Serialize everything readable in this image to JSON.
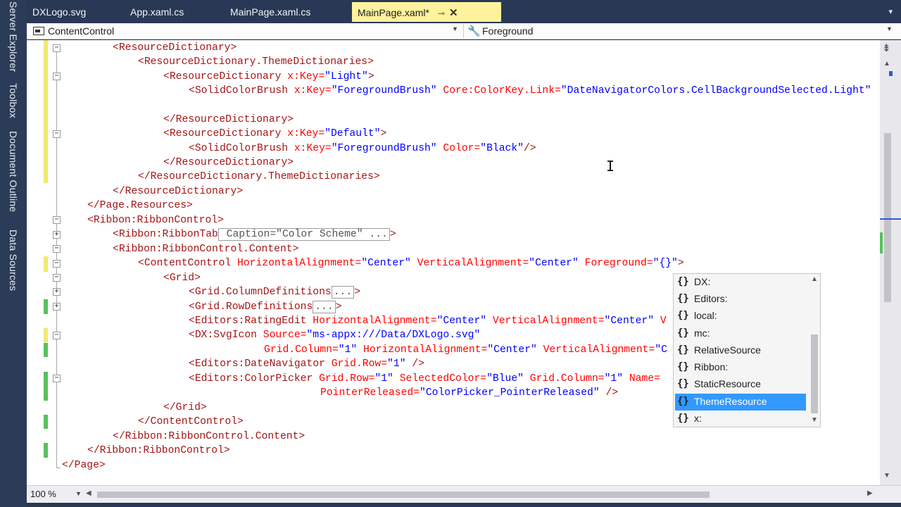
{
  "sidebar_tabs": [
    "Server Explorer",
    "Toolbox",
    "Document Outline",
    "Data Sources"
  ],
  "tabs": [
    "DXLogo.svg",
    "App.xaml.cs",
    "MainPage.xaml.cs",
    "MainPage.xaml*"
  ],
  "nav": {
    "element": "ContentControl",
    "property": "Foreground"
  },
  "code": {
    "l1": "<ResourceDictionary>",
    "l2": "<ResourceDictionary.ThemeDictionaries>",
    "l3a": "<ResourceDictionary ",
    "l3b": "x:Key=",
    "l3c": "\"Light\"",
    "l3d": ">",
    "l4a": "<SolidColorBrush ",
    "l4b": "x:Key=",
    "l4c": "\"ForegroundBrush\"",
    "l4d": " Core:ColorKey.Link=",
    "l4e": "\"DateNavigatorColors.CellBackgroundSelected.Light\"",
    "l6": "</ResourceDictionary>",
    "l7a": "<ResourceDictionary ",
    "l7b": "x:Key=",
    "l7c": "\"Default\"",
    "l7d": ">",
    "l8a": "<SolidColorBrush ",
    "l8b": "x:Key=",
    "l8c": "\"ForegroundBrush\"",
    "l8d": " Color=",
    "l8e": "\"Black\"",
    "l8f": "/>",
    "l9": "</ResourceDictionary>",
    "l10": "</ResourceDictionary.ThemeDictionaries>",
    "l11": "</ResourceDictionary>",
    "l12": "</Page.Resources>",
    "l13": "<Ribbon:RibbonControl>",
    "l14a": "<Ribbon:RibbonTab",
    "l14b": " Caption=\"Color Scheme\" ...",
    "l14c": ">",
    "l15": "<Ribbon:RibbonControl.Content>",
    "l16a": "<ContentControl ",
    "l16b": "HorizontalAlignment=",
    "l16c": "\"Center\"",
    "l16d": " VerticalAlignment=",
    "l16e": "\"Center\"",
    "l16f": " Foreground=",
    "l16g": "\"{}\"",
    "l16h": ">",
    "l17": "<Grid>",
    "l18a": "<Grid.ColumnDefinitions",
    "l18b": "...",
    "l18c": ">",
    "l19a": "<Grid.RowDefinitions",
    "l19b": "...",
    "l19c": ">",
    "l20a": "<Editors:RatingEdit ",
    "l20b": "HorizontalAlignment=",
    "l20c": "\"Center\"",
    "l20d": " VerticalAlignment=",
    "l20e": "\"Center\"",
    "l20f": " V",
    "l21a": "<DX:SvgIcon ",
    "l21b": "Source=",
    "l21c": "\"ms-appx:///Data/DXLogo.svg\"",
    "l22a": "Grid.Column=",
    "l22b": "\"1\"",
    "l22c": " HorizontalAlignment=",
    "l22d": "\"Center\"",
    "l22e": " VerticalAlignment=",
    "l22f": "\"C",
    "l23a": "<Editors:DateNavigator ",
    "l23b": "Grid.Row=",
    "l23c": "\"1\"",
    "l23d": " />",
    "l24a": "<Editors:ColorPicker ",
    "l24b": "Grid.Row=",
    "l24c": "\"1\"",
    "l24d": " SelectedColor=",
    "l24e": "\"Blue\"",
    "l24f": " Grid.Column=",
    "l24g": "\"1\"",
    "l24h": " Name=",
    "l25a": "PointerReleased=",
    "l25b": "\"ColorPicker_PointerReleased\"",
    "l25c": " />",
    "l26": "</Grid>",
    "l27": "</ContentControl>",
    "l28": "</Ribbon:RibbonControl.Content>",
    "l29": "</Ribbon:RibbonControl>",
    "l30": "</Page>"
  },
  "completion": {
    "items": [
      "DX:",
      "Editors:",
      "local:",
      "mc:",
      "RelativeSource",
      "Ribbon:",
      "StaticResource",
      "ThemeResource",
      "x:"
    ],
    "selected": "ThemeResource"
  },
  "zoom": "100 %",
  "colors": {
    "active_tab": "#fff29d",
    "selection": "#3399ff",
    "tag": "#a31515",
    "attribute": "#ff0000",
    "value": "#0000ff"
  }
}
